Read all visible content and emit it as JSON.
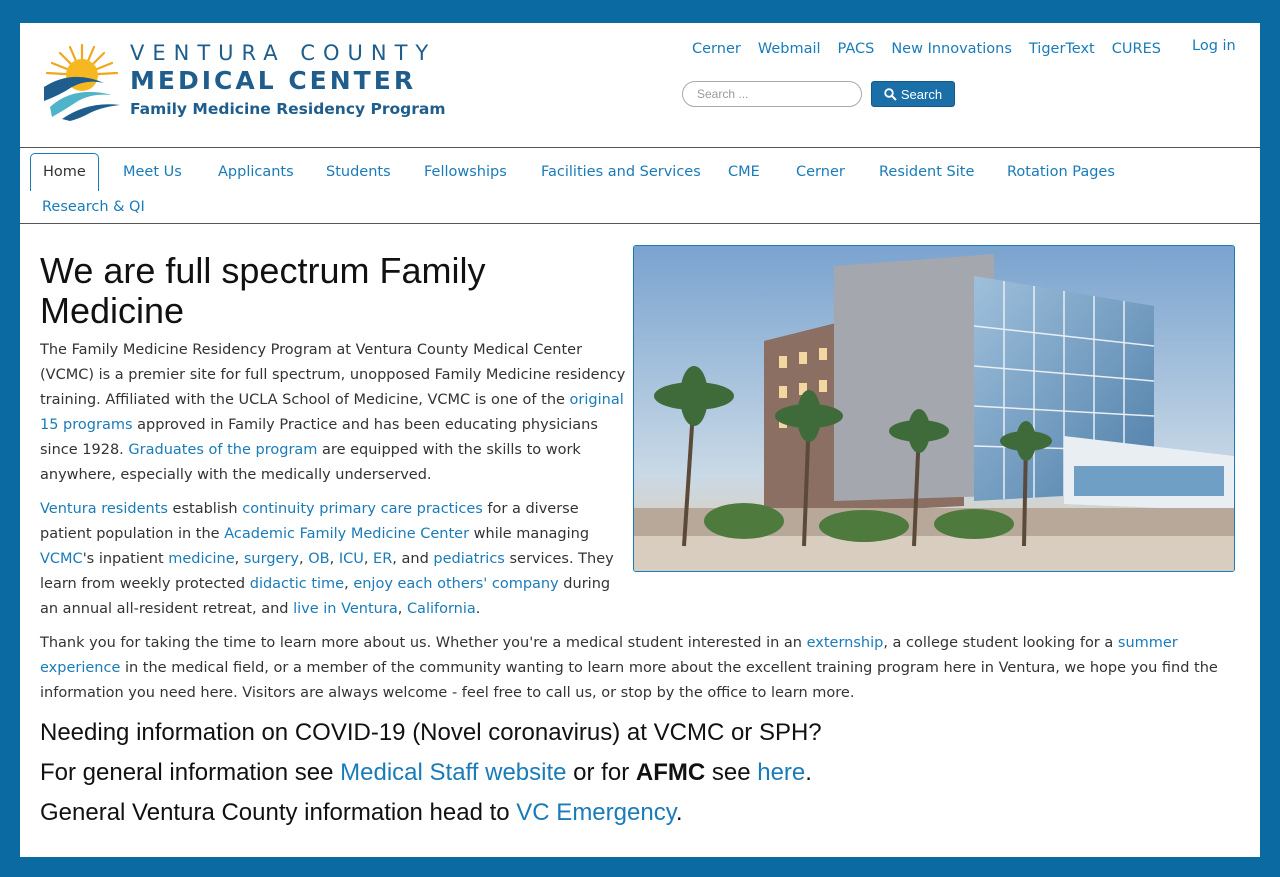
{
  "logo": {
    "line1": "VENTURA COUNTY",
    "line2": "MEDICAL CENTER",
    "line3": "Family Medicine Residency Program"
  },
  "toplinks": [
    "Cerner",
    "Webmail",
    "PACS",
    "New Innovations",
    "TigerText",
    "CURES"
  ],
  "login": "Log in",
  "search": {
    "placeholder": "Search ...",
    "button": "Search"
  },
  "nav": [
    "Home",
    "Meet Us",
    "Applicants",
    "Students",
    "Fellowships",
    "Facilities and Services",
    "CME",
    "Cerner",
    "Resident Site",
    "Rotation Pages",
    "Research & QI"
  ],
  "main": {
    "title": "We are full spectrum Family Medicine",
    "p1": {
      "t1": "The Family Medicine Residency Program at Ventura County Medical Center (VCMC) is a premier site for full spectrum, unopposed Family Medicine residency training. Affiliated with the UCLA School of Medicine, VCMC is one of the ",
      "l1": "original 15 programs",
      "t2": " approved in Family Practice and has been educating physicians since 1928. ",
      "l2": "Graduates of the program",
      "t3": " are equipped with the skills to work anywhere, especially with the medically underserved."
    },
    "p2": {
      "l1": "Ventura residents",
      "t1": " establish ",
      "l2": "continuity primary care practices",
      "t2": " for a diverse patient population in the ",
      "l3": "Academic Family Medicine Center",
      "t3": " while managing ",
      "l4": "VCMC",
      "t4": "'s inpatient ",
      "l5": "medicine",
      "s1": ", ",
      "l6": "surgery",
      "s2": ", ",
      "l7": "OB",
      "s3": ", ",
      "l8": "ICU",
      "s4": ", ",
      "l9": "ER",
      "t5": ", and ",
      "l10": "pediatrics",
      "t6": " services. They learn from weekly protected ",
      "l11": "didactic time",
      "s5": ", ",
      "l12": "enjoy each others' company",
      "t7": " during an annual all-resident retreat, and ",
      "l13": "live in Ventura",
      "s6": ", ",
      "l14": "California",
      "t8": "."
    },
    "p3": {
      "t1": "Thank you for taking the time to learn more about us.  Whether you're a medical student interested in an ",
      "l1": "externship",
      "t2": ", a college student looking for a ",
      "l2": "summer experience",
      "t3": " in the medical field, or a member of the community wanting to learn more about the excellent training program here in Ventura, we hope you find the information you need here.  Visitors are always welcome - feel free to call us, or stop by the office to learn more."
    },
    "covid": {
      "line1": "Needing information on COVID-19 (Novel coronavirus) at VCMC or SPH?",
      "line2_t1": "For general information see ",
      "line2_l1": "Medical Staff website",
      "line2_t2": " or for ",
      "line2_b": "AFMC",
      "line2_t3": " see ",
      "line2_l2": "here",
      "line2_t4": ".",
      "line3_t1": "General Ventura County information head to ",
      "line3_l1": "VC Emergency",
      "line3_t2": "."
    }
  }
}
